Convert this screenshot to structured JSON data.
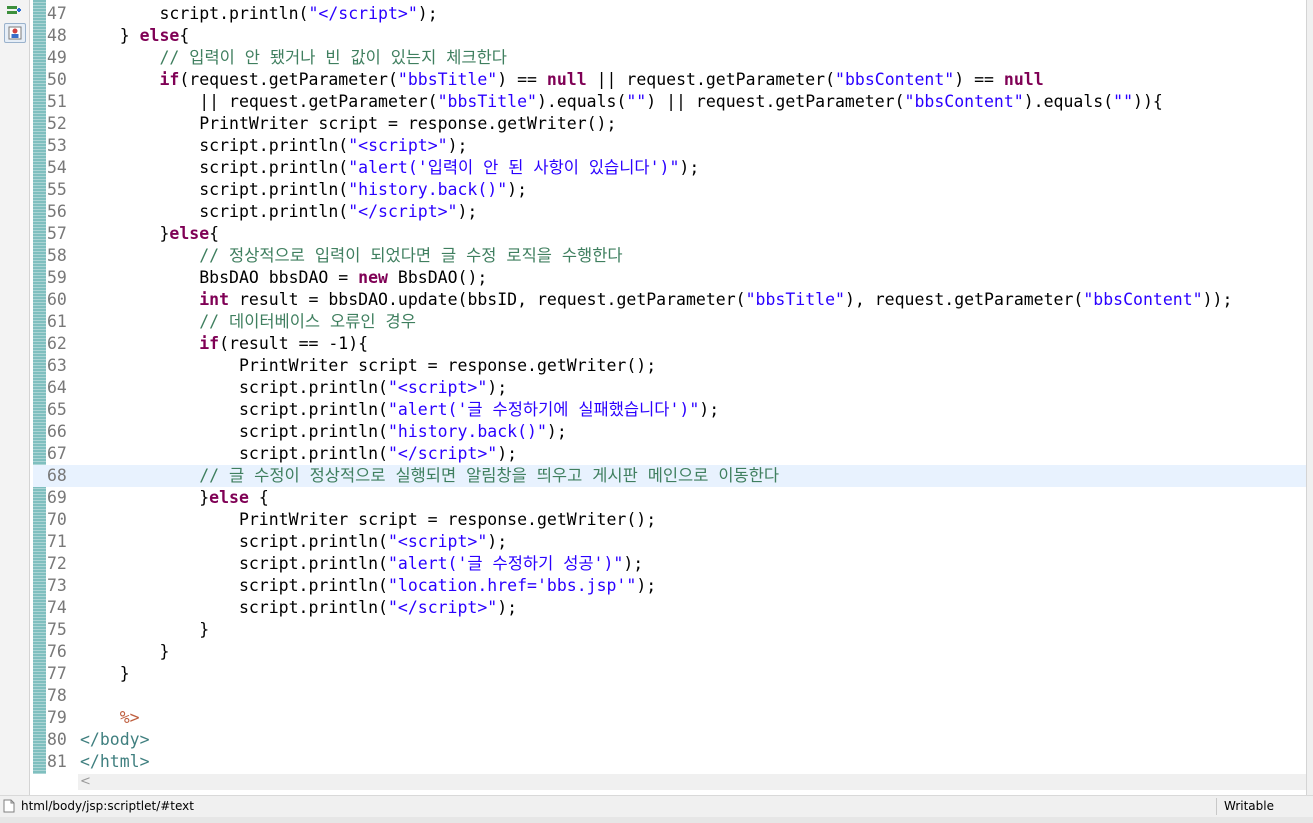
{
  "toolbar": {
    "icons": [
      "add-icon",
      "user-stamp-icon"
    ]
  },
  "editor": {
    "current_line": "68",
    "lines": [
      {
        "no": "47",
        "html": "        script.println(<span class=\"str\">\"&lt;/script&gt;\"</span>);"
      },
      {
        "no": "48",
        "html": "    } <span class=\"kw\">else</span>{"
      },
      {
        "no": "49",
        "html": "        <span class=\"cmt\">// 입력이 안 됐거나 빈 값이 있는지 체크한다</span>"
      },
      {
        "no": "50",
        "html": "        <span class=\"kw\">if</span>(request.getParameter(<span class=\"str\">\"bbsTitle\"</span>) == <span class=\"kw\">null</span> || request.getParameter(<span class=\"str\">\"bbsContent\"</span>) == <span class=\"kw\">null</span>"
      },
      {
        "no": "51",
        "html": "            || request.getParameter(<span class=\"str\">\"bbsTitle\"</span>).equals(<span class=\"str\">\"\"</span>) || request.getParameter(<span class=\"str\">\"bbsContent\"</span>).equals(<span class=\"str\">\"\"</span>)){"
      },
      {
        "no": "52",
        "html": "            PrintWriter script = response.getWriter();"
      },
      {
        "no": "53",
        "html": "            script.println(<span class=\"str\">\"&lt;script&gt;\"</span>);"
      },
      {
        "no": "54",
        "html": "            script.println(<span class=\"str\">\"alert('입력이 안 된 사항이 있습니다')\"</span>);"
      },
      {
        "no": "55",
        "html": "            script.println(<span class=\"str\">\"history.back()\"</span>);"
      },
      {
        "no": "56",
        "html": "            script.println(<span class=\"str\">\"&lt;/script&gt;\"</span>);"
      },
      {
        "no": "57",
        "html": "        }<span class=\"kw\">else</span>{"
      },
      {
        "no": "58",
        "html": "            <span class=\"cmt\">// 정상적으로 입력이 되었다면 글 수정 로직을 수행한다</span>"
      },
      {
        "no": "59",
        "html": "            BbsDAO bbsDAO = <span class=\"kw\">new</span> BbsDAO();"
      },
      {
        "no": "60",
        "html": "            <span class=\"kw\">int</span> result = bbsDAO.update(bbsID, request.getParameter(<span class=\"str\">\"bbsTitle\"</span>), request.getParameter(<span class=\"str\">\"bbsContent\"</span>));"
      },
      {
        "no": "61",
        "html": "            <span class=\"cmt\">// 데이터베이스 오류인 경우</span>"
      },
      {
        "no": "62",
        "html": "            <span class=\"kw\">if</span>(result == -1){"
      },
      {
        "no": "63",
        "html": "                PrintWriter script = response.getWriter();"
      },
      {
        "no": "64",
        "html": "                script.println(<span class=\"str\">\"&lt;script&gt;\"</span>);"
      },
      {
        "no": "65",
        "html": "                script.println(<span class=\"str\">\"alert('글 수정하기에 실패했습니다')\"</span>);"
      },
      {
        "no": "66",
        "html": "                script.println(<span class=\"str\">\"history.back()\"</span>);"
      },
      {
        "no": "67",
        "html": "                script.println(<span class=\"str\">\"&lt;/script&gt;\"</span>);"
      },
      {
        "no": "68",
        "html": "            <span class=\"cmt\">// 글 수정이 정상적으로 실행되면 알림창을 띄우고 게시판 메인으로 이동한다</span>"
      },
      {
        "no": "69",
        "html": "            }<span class=\"kw\">else</span> {"
      },
      {
        "no": "70",
        "html": "                PrintWriter script = response.getWriter();"
      },
      {
        "no": "71",
        "html": "                script.println(<span class=\"str\">\"&lt;script&gt;\"</span>);"
      },
      {
        "no": "72",
        "html": "                script.println(<span class=\"str\">\"alert('글 수정하기 성공')\"</span>);"
      },
      {
        "no": "73",
        "html": "                script.println(<span class=\"str\">\"location.href='bbs.jsp'\"</span>);"
      },
      {
        "no": "74",
        "html": "                script.println(<span class=\"str\">\"&lt;/script&gt;\"</span>);"
      },
      {
        "no": "75",
        "html": "            }"
      },
      {
        "no": "76",
        "html": "        }"
      },
      {
        "no": "77",
        "html": "    }"
      },
      {
        "no": "78",
        "html": ""
      },
      {
        "no": "79",
        "html": "    <span class=\"jsp\">%&gt;</span>"
      },
      {
        "no": "80",
        "html": "<span class=\"tag\">&lt;/body&gt;</span>"
      },
      {
        "no": "81",
        "html": "<span class=\"tag\">&lt;/html&gt;</span>"
      }
    ]
  },
  "scrollbar": {
    "left_arrow": "<"
  },
  "status_bar": {
    "path": "html/body/jsp:scriptlet/#text",
    "mode": "Writable"
  }
}
